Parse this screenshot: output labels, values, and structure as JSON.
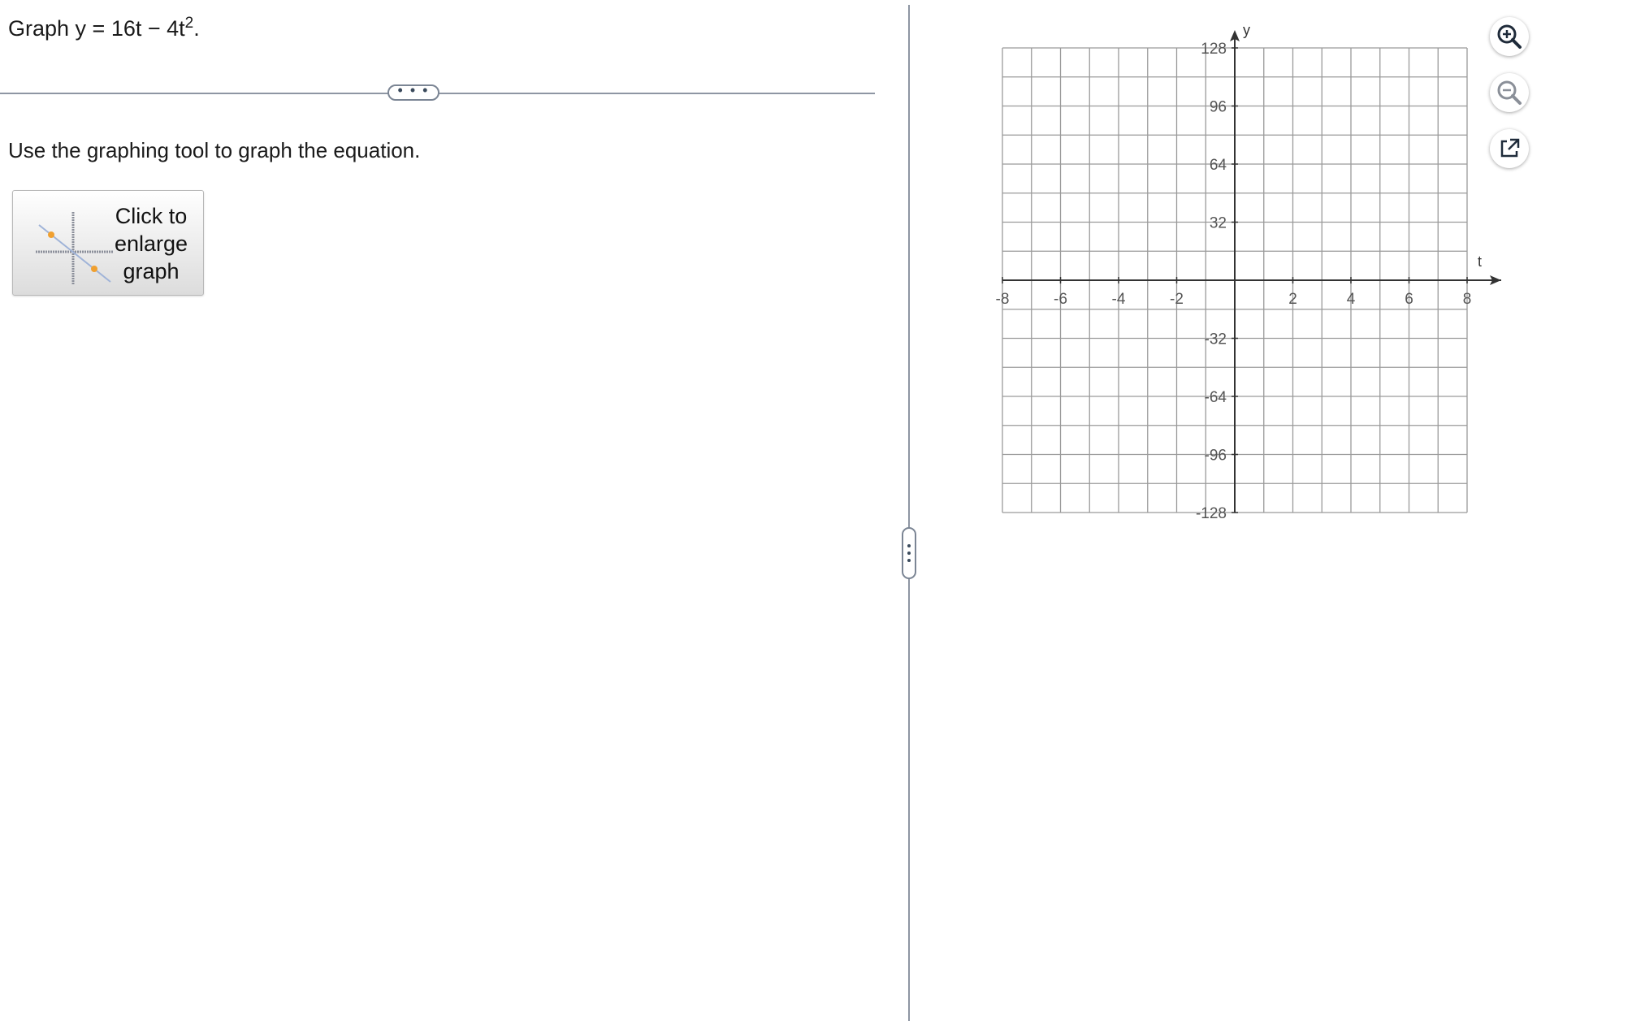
{
  "question": {
    "prefix": "Graph y = 16t − 4t",
    "exponent": "2",
    "suffix": "."
  },
  "more_button": "• • •",
  "instruction": "Use the graphing tool to graph the equation.",
  "enlarge_button": {
    "label": "Click to\nenlarge\ngraph"
  },
  "graph": {
    "x_axis_label": "t",
    "y_axis_label": "y",
    "x_ticks": [
      "-8",
      "-6",
      "-4",
      "-2",
      "2",
      "4",
      "6",
      "8"
    ],
    "y_ticks": [
      "128",
      "96",
      "64",
      "32",
      "-32",
      "-64",
      "-96",
      "-128"
    ],
    "x_range": [
      -8,
      8
    ],
    "y_range": [
      -128,
      128
    ],
    "x_grid_step": 1,
    "y_grid_step": 16,
    "grid": true
  },
  "tools": {
    "zoom_in": "zoom-in-icon",
    "zoom_out": "zoom-out-icon",
    "popout": "external-link-icon"
  }
}
